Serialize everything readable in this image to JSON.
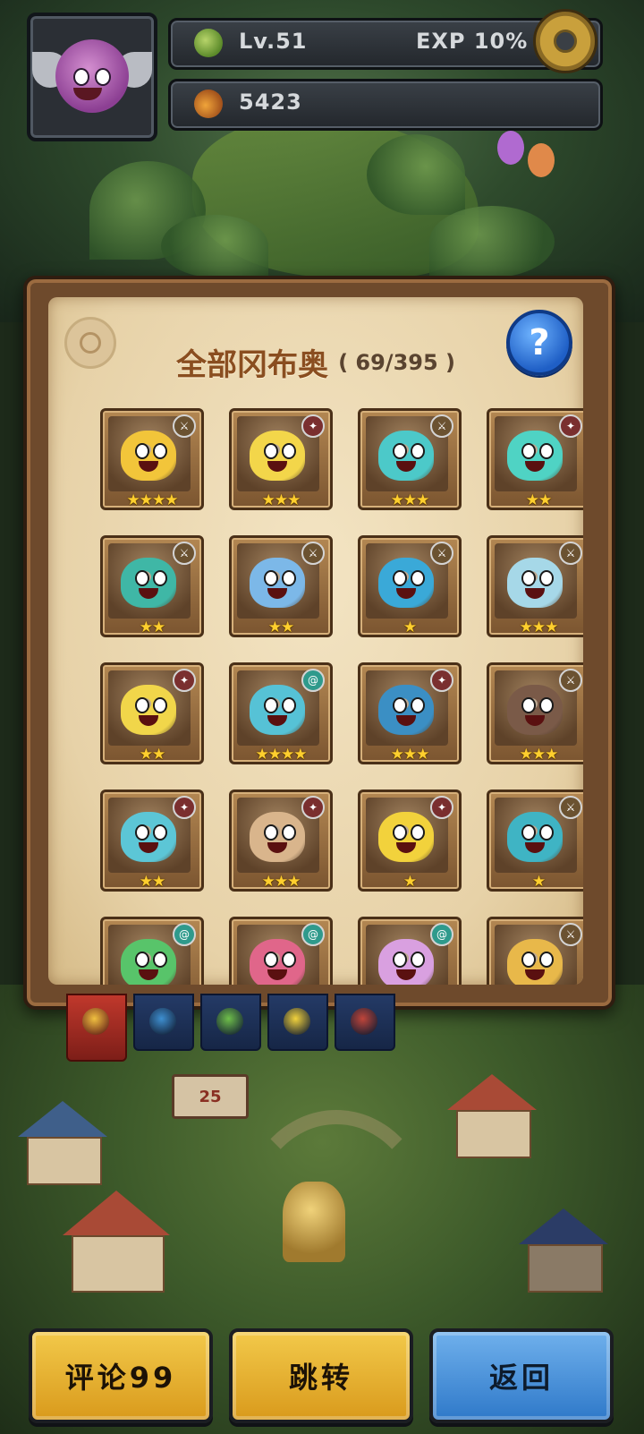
{
  "hud": {
    "level_text": "Lv.51",
    "exp_text": "EXP 10%",
    "currency_amount": "5423",
    "icons": [
      "avatar-portrait",
      "leaf-level-icon",
      "settings-gear-icon",
      "acorn-currency-icon"
    ]
  },
  "collection": {
    "title": "全部冈布奥",
    "count": "( 69/395 )",
    "help_label": "?",
    "cards": [
      {
        "class": "sword",
        "stars": "★★★★",
        "color": "#f2c53a"
      },
      {
        "class": "magic",
        "stars": "★★★",
        "color": "#f3d64a"
      },
      {
        "class": "sword",
        "stars": "★★★",
        "color": "#4cc9c9"
      },
      {
        "class": "magic",
        "stars": "★★",
        "color": "#4fd3c4"
      },
      {
        "class": "sword",
        "stars": "★★",
        "color": "#3fb7a6"
      },
      {
        "class": "sword",
        "stars": "★★",
        "color": "#7cb8e8"
      },
      {
        "class": "sword",
        "stars": "★",
        "color": "#3aa9d8"
      },
      {
        "class": "sword",
        "stars": "★★★",
        "color": "#a6d8e8"
      },
      {
        "class": "magic",
        "stars": "★★",
        "color": "#f1d64a"
      },
      {
        "class": "spiral",
        "stars": "★★★★",
        "color": "#56c2d6"
      },
      {
        "class": "magic",
        "stars": "★★★",
        "color": "#3b8fc4"
      },
      {
        "class": "sword",
        "stars": "★★★",
        "color": "#7a5a48"
      },
      {
        "class": "magic",
        "stars": "★★",
        "color": "#5cc6d6"
      },
      {
        "class": "magic",
        "stars": "★★★",
        "color": "#d9b58c"
      },
      {
        "class": "magic",
        "stars": "★",
        "color": "#f2d23c"
      },
      {
        "class": "sword",
        "stars": "★",
        "color": "#3fb4c4"
      },
      {
        "class": "spiral",
        "stars": "",
        "color": "#58c46a"
      },
      {
        "class": "spiral",
        "stars": "",
        "color": "#e0668a"
      },
      {
        "class": "spiral",
        "stars": "",
        "color": "#d9a0e0"
      },
      {
        "class": "sword",
        "stars": "",
        "color": "#e8b84a"
      }
    ]
  },
  "tabs": [
    {
      "name": "all",
      "color": "#f0c040",
      "active": true
    },
    {
      "name": "blue",
      "color": "#3e8fd0",
      "active": false
    },
    {
      "name": "green",
      "color": "#6fbf4a",
      "active": false
    },
    {
      "name": "gold",
      "color": "#f2d23c",
      "active": false
    },
    {
      "name": "red",
      "color": "#c0453a",
      "active": false
    }
  ],
  "map": {
    "sign_number": "25"
  },
  "buttons": {
    "comment": "评论99",
    "jump": "跳转",
    "back": "返回"
  }
}
